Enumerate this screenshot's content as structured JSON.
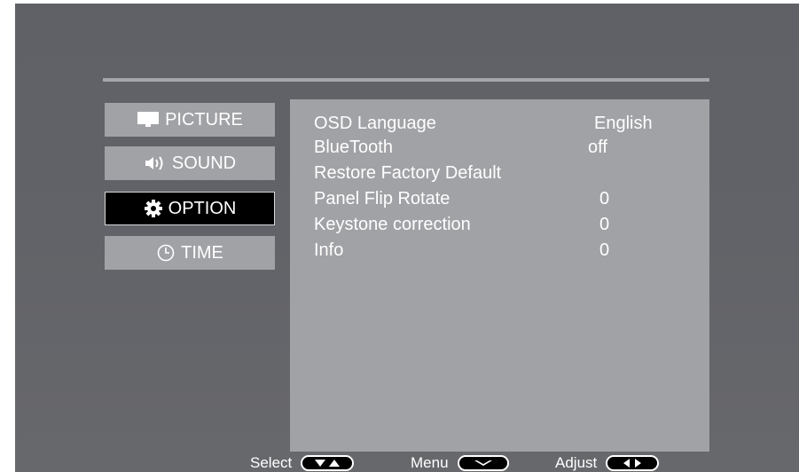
{
  "menu": {
    "tabs": [
      {
        "label": "PICTURE",
        "icon": "monitor-icon",
        "active": false
      },
      {
        "label": "SOUND",
        "icon": "speaker-icon",
        "active": false
      },
      {
        "label": "OPTION",
        "icon": "gear-icon",
        "active": true
      },
      {
        "label": "TIME",
        "icon": "clock-icon",
        "active": false
      }
    ]
  },
  "options": [
    {
      "label": "OSD Language",
      "value": "English"
    },
    {
      "label": "BlueTooth",
      "value": "off"
    },
    {
      "label": "Restore Factory Default",
      "value": ""
    },
    {
      "label": "Panel Flip Rotate",
      "value": "0"
    },
    {
      "label": "Keystone correction",
      "value": "0"
    },
    {
      "label": "Info",
      "value": "0"
    }
  ],
  "footer": {
    "select_label": "Select",
    "menu_label": "Menu",
    "adjust_label": "Adjust"
  },
  "colors": {
    "background": "#626368",
    "panel": "#a1a2a6",
    "active_tab": "#000000",
    "text": "#ffffff"
  }
}
